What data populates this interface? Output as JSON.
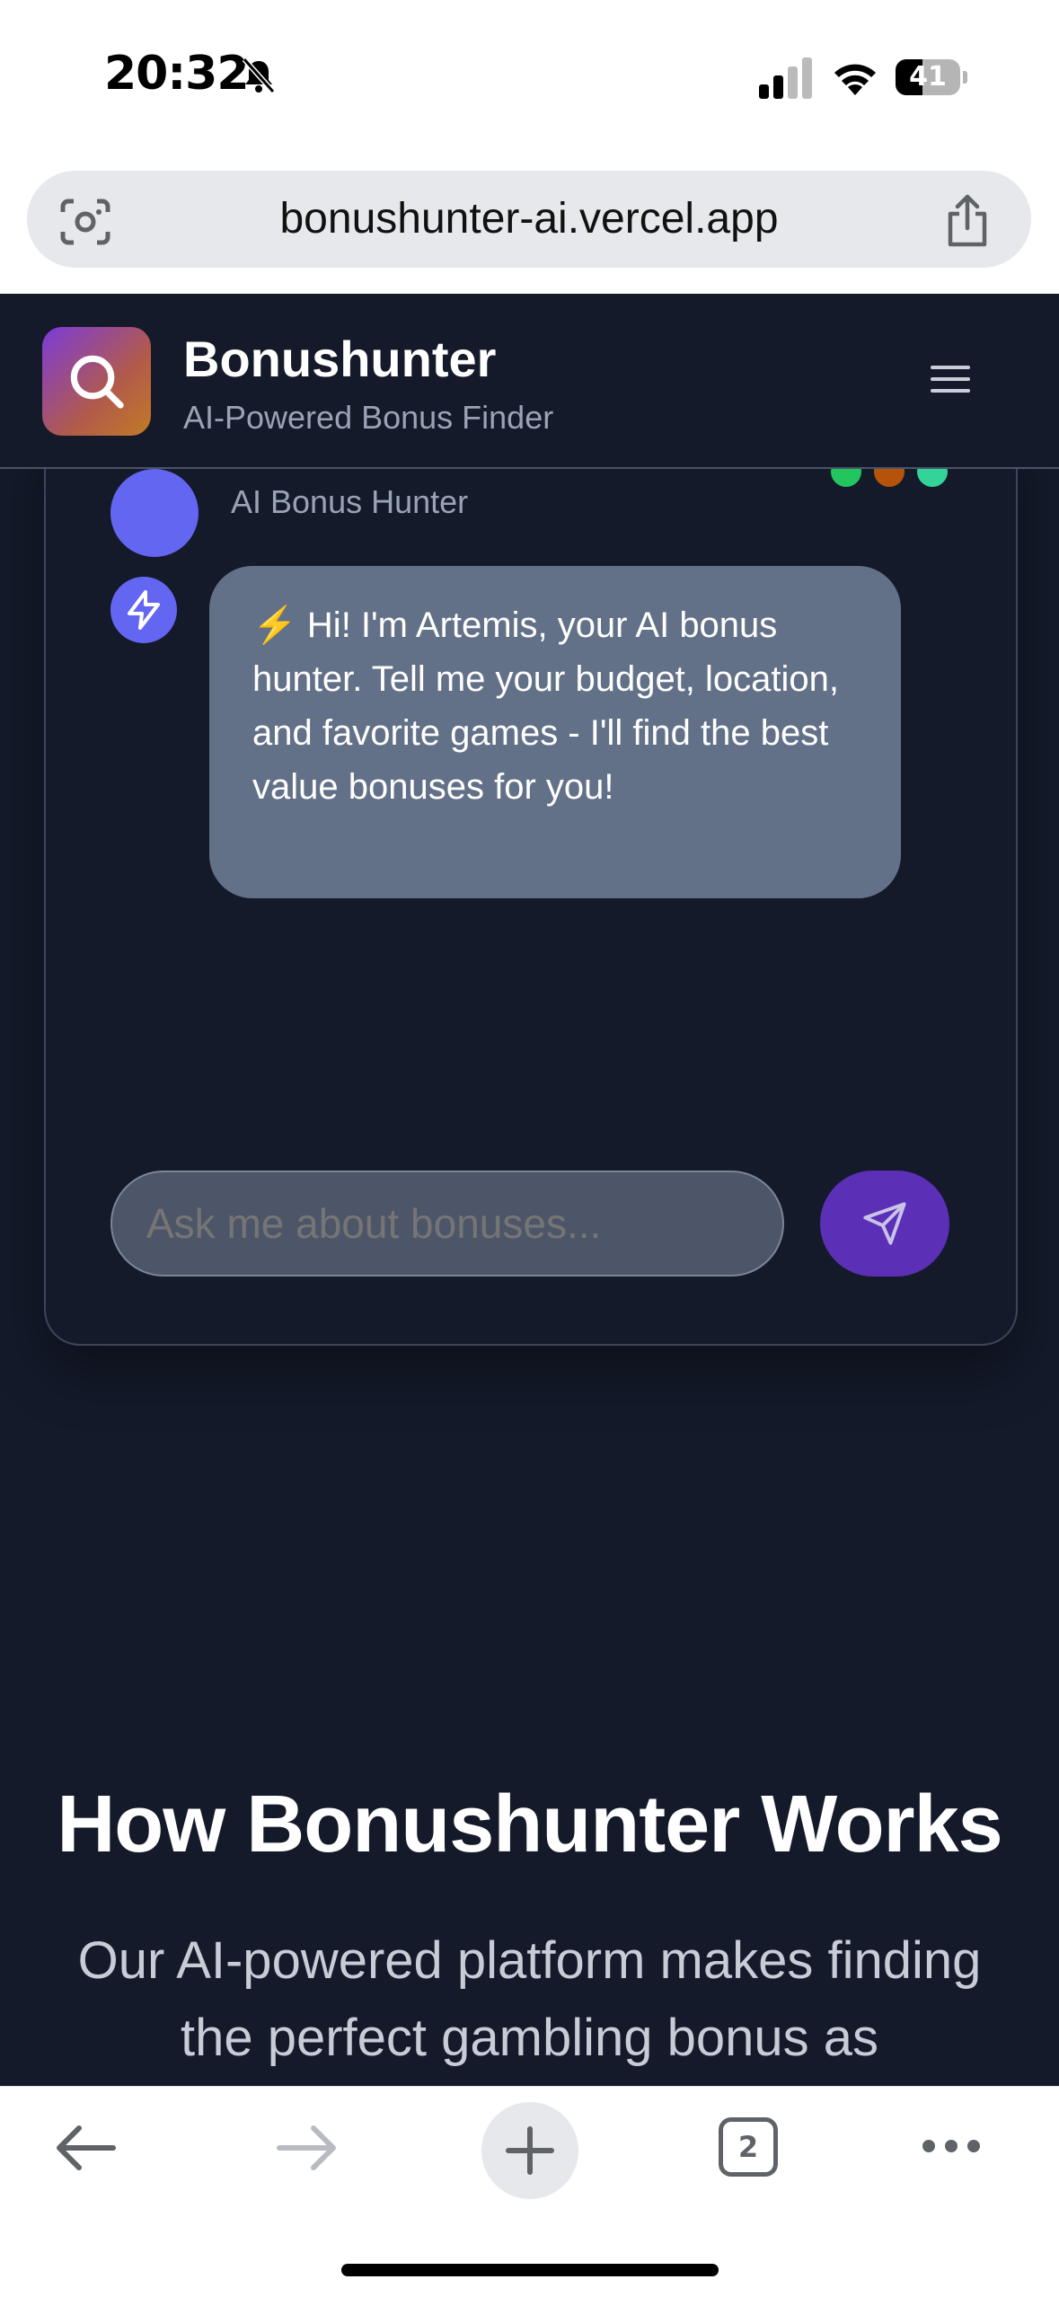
{
  "status_bar": {
    "time": "20:32",
    "battery_level": "41",
    "battery_fraction": 0.41
  },
  "browser": {
    "url": "bonushunter-ai.vercel.app",
    "open_tabs": "2"
  },
  "header": {
    "title": "Bonushunter",
    "subtitle": "AI-Powered Bonus Finder"
  },
  "chat": {
    "assistant_subtitle": "AI Bonus Hunter",
    "status_dot_colors": [
      "#22c55e",
      "#b45309",
      "#34d399"
    ],
    "greeting": "⚡ Hi! I'm Artemis, your AI bonus hunter. Tell me your budget, location, and favorite games - I'll find the best value bonuses for you!",
    "input_placeholder": "Ask me about bonuses..."
  },
  "how_it_works": {
    "title": "How Bonushunter Works",
    "description": "Our AI-powered platform makes finding the perfect gambling bonus as"
  },
  "colors": {
    "page_bg": "#141a2a",
    "accent": "#6366f1",
    "send_button": "#5b2fb6",
    "bubble": "#637188"
  }
}
